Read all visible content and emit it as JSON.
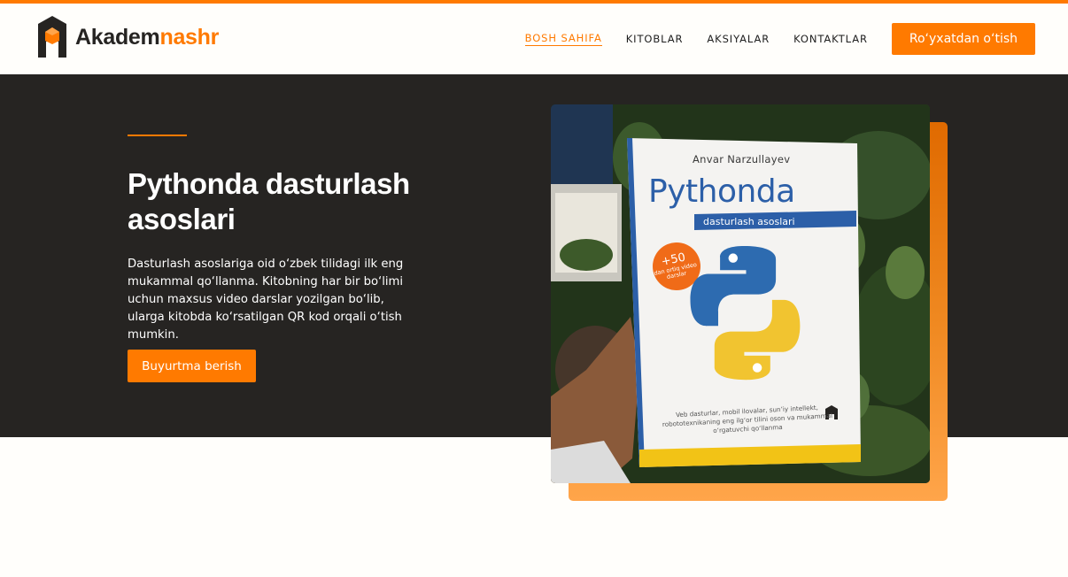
{
  "brand": {
    "name_part1": "Akadem",
    "name_part2": "nashr",
    "accent_color": "#ff7a00",
    "dark_color": "#262422"
  },
  "nav": {
    "items": [
      {
        "label": "BOSH SAHIFA",
        "active": true
      },
      {
        "label": "KITOBLAR",
        "active": false
      },
      {
        "label": "AKSIYALAR",
        "active": false
      },
      {
        "label": "KONTAKTLAR",
        "active": false
      }
    ],
    "register_label": "Ro‘yxatdan o‘tish"
  },
  "hero": {
    "title": "Pythonda dasturlash asoslari",
    "description": "Dasturlash asoslariga oid o‘zbek tilidagi ilk eng mukammal qo‘llanma. Kitobning har bir bo‘limi uchun maxsus video darslar yozilgan bo‘lib, ularga kitobda ko‘rsatilgan QR kod orqali o‘tish mumkin.",
    "order_label": "Buyurtma berish"
  },
  "book": {
    "author": "Anvar Narzullayev",
    "title": "Pythonda",
    "subtitle": "dasturlash asoslari",
    "badge_big": "+50",
    "badge_small": "dan ortiq video darslar",
    "description": "Veb dasturlar, mobil ilovalar, sun’iy intellekt, robototexnikaning eng ilg‘or tilini oson va mukammal o‘rgatuvchi qo‘llanma",
    "icons": [
      "python-logo-icon",
      "publisher-logo-icon"
    ]
  }
}
